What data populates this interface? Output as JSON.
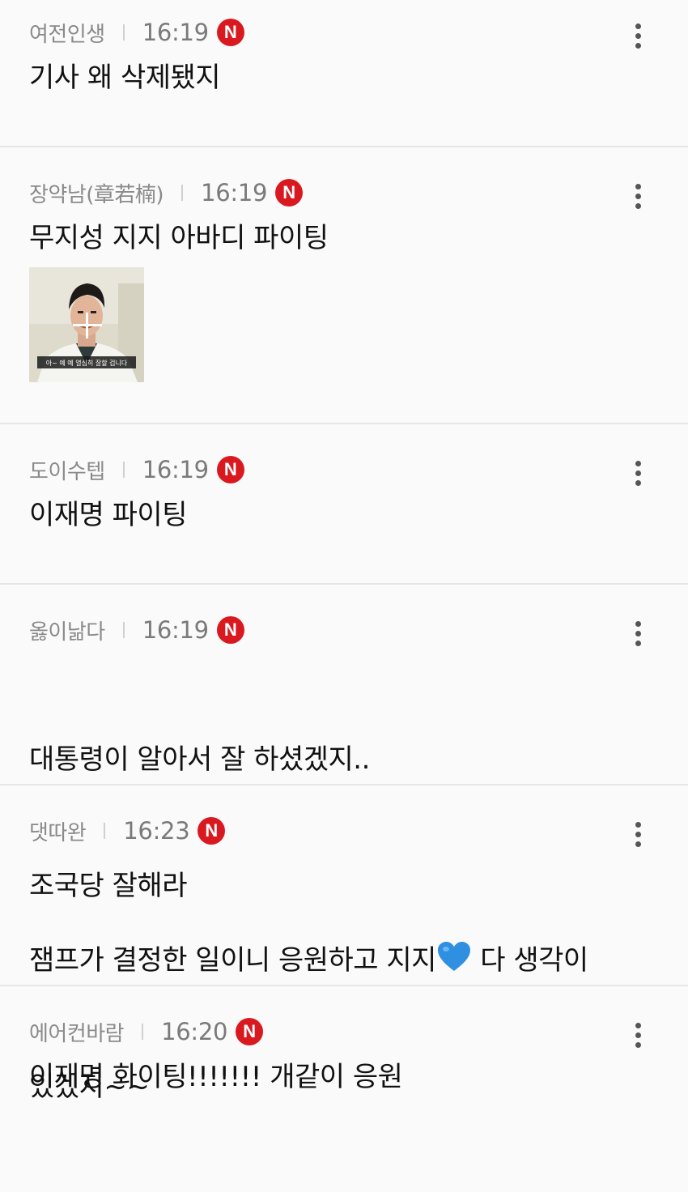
{
  "comments": [
    {
      "author": "여전인생",
      "time": "16:19",
      "badge": "N",
      "text": "기사 왜 삭제됐지"
    },
    {
      "author": "장약남(章若楠)",
      "time": "16:19",
      "badge": "N",
      "text": "무지성 지지 아바디 파이팅",
      "image_caption": "아~ 예 예 열심히 잘할 겁니다"
    },
    {
      "author": "도이수텝",
      "time": "16:19",
      "badge": "N",
      "text": "이재명 파이팅"
    },
    {
      "author": "옳이낢다",
      "time": "16:19",
      "badge": "N",
      "text_line1": "대통령이 알아서 잘 하셨겠지..",
      "text_line2": "조국당 잘해라"
    },
    {
      "author": "댓따완",
      "time": "16:23",
      "badge": "N",
      "text_part1": "잼프가 결정한 일이니 응원하고 지지",
      "text_part2": " 다 생각이",
      "text_line2": "있겠지~~",
      "emoji": "blue-heart"
    },
    {
      "author": "에어컨바람",
      "time": "16:20",
      "badge": "N",
      "text": "이재명 화이팅!!!!!!! 개같이 응원"
    }
  ],
  "colors": {
    "badge": "#d9191f",
    "author": "#8a8a8a",
    "divider": "#e6e6e6",
    "heart": "#2f8fe0"
  },
  "icons": [
    "n-badge-icon",
    "more-options-icon",
    "blue-heart-icon"
  ]
}
